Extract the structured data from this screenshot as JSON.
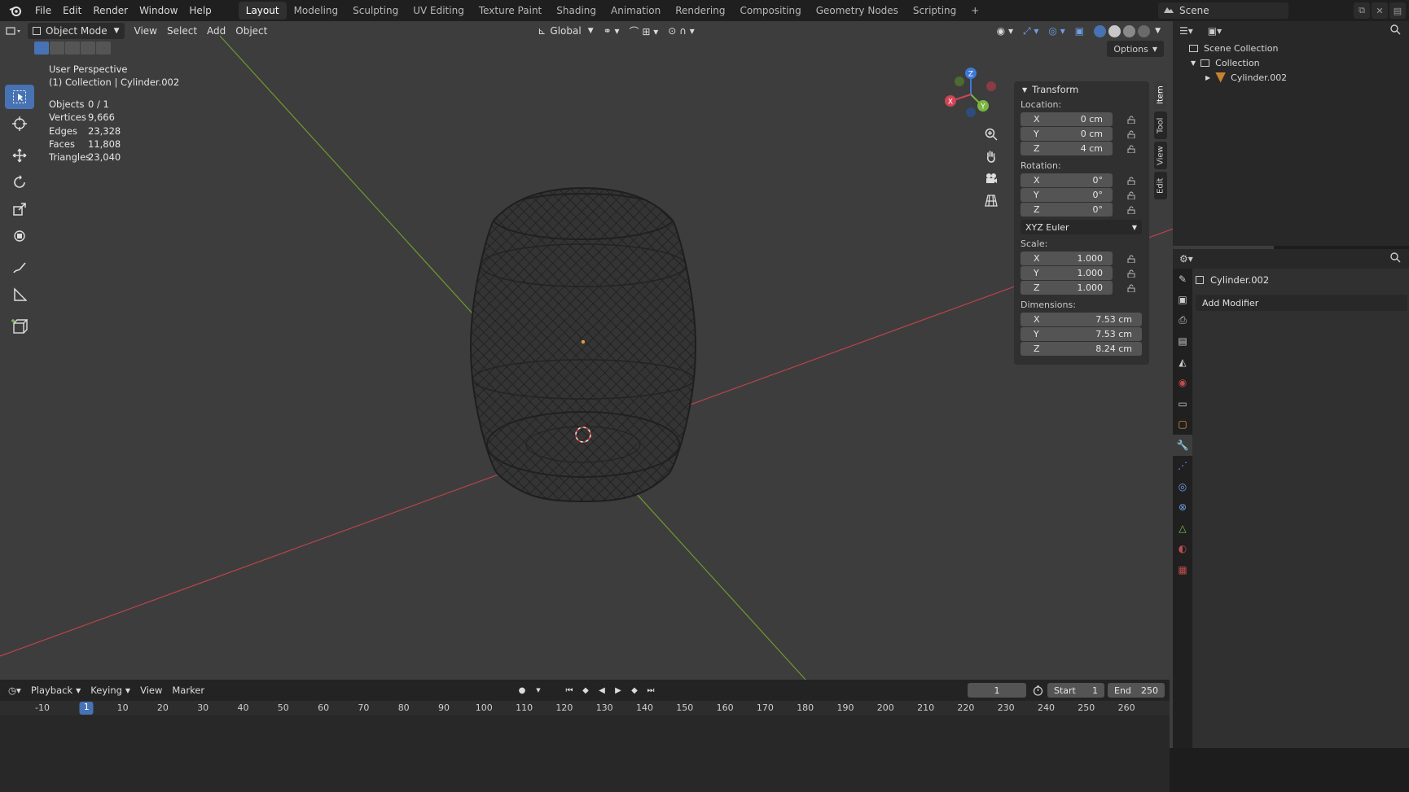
{
  "app": {
    "menus": [
      "File",
      "Edit",
      "Render",
      "Window",
      "Help"
    ],
    "workspaces": [
      "Layout",
      "Modeling",
      "Sculpting",
      "UV Editing",
      "Texture Paint",
      "Shading",
      "Animation",
      "Rendering",
      "Compositing",
      "Geometry Nodes",
      "Scripting"
    ],
    "active_workspace": "Layout",
    "add_workspace": "+",
    "scene_name": "Scene"
  },
  "viewport": {
    "mode": "Object Mode",
    "menus": [
      "View",
      "Select",
      "Add",
      "Object"
    ],
    "orientation": "Global",
    "options_label": "Options",
    "view_name": "User Perspective",
    "collection_line": "(1) Collection | Cylinder.002",
    "stats": [
      {
        "key": "Objects",
        "value": "0 / 1"
      },
      {
        "key": "Vertices",
        "value": "9,666"
      },
      {
        "key": "Edges",
        "value": "23,328"
      },
      {
        "key": "Faces",
        "value": "11,808"
      },
      {
        "key": "Triangles",
        "value": "23,040"
      }
    ],
    "gizmo_labels": {
      "x": "X",
      "y": "Y",
      "z": "Z"
    },
    "colors": {
      "background": "#3d3d3d",
      "x_axis": "#c04d4d",
      "y_axis": "#7aa23b",
      "selection": "#4772b3"
    }
  },
  "npanel": {
    "title": "Transform",
    "location_label": "Location:",
    "location": [
      {
        "axis": "X",
        "value": "0 cm"
      },
      {
        "axis": "Y",
        "value": "0 cm"
      },
      {
        "axis": "Z",
        "value": "4 cm"
      }
    ],
    "rotation_label": "Rotation:",
    "rotation": [
      {
        "axis": "X",
        "value": "0°"
      },
      {
        "axis": "Y",
        "value": "0°"
      },
      {
        "axis": "Z",
        "value": "0°"
      }
    ],
    "rotation_mode": "XYZ Euler",
    "scale_label": "Scale:",
    "scale": [
      {
        "axis": "X",
        "value": "1.000"
      },
      {
        "axis": "Y",
        "value": "1.000"
      },
      {
        "axis": "Z",
        "value": "1.000"
      }
    ],
    "dimensions_label": "Dimensions:",
    "dimensions": [
      {
        "axis": "X",
        "value": "7.53 cm"
      },
      {
        "axis": "Y",
        "value": "7.53 cm"
      },
      {
        "axis": "Z",
        "value": "8.24 cm"
      }
    ],
    "tabs": [
      "Item",
      "Tool",
      "View",
      "Edit"
    ],
    "active_tab": "Item"
  },
  "outliner": {
    "rows": [
      "Scene Collection",
      "Collection",
      "Cylinder.002"
    ]
  },
  "properties": {
    "object_name": "Cylinder.002",
    "add_modifier": "Add Modifier"
  },
  "timeline": {
    "menus": [
      "Playback",
      "Keying",
      "View",
      "Marker"
    ],
    "current_frame": "1",
    "start_label": "Start",
    "start_value": "1",
    "end_label": "End",
    "end_value": "250",
    "ruler": [
      "-10",
      "1",
      "10",
      "20",
      "30",
      "40",
      "50",
      "60",
      "70",
      "80",
      "90",
      "100",
      "110",
      "120",
      "130",
      "140",
      "150",
      "160",
      "170",
      "180",
      "190",
      "200",
      "210",
      "220",
      "230",
      "240",
      "250",
      "260"
    ]
  }
}
